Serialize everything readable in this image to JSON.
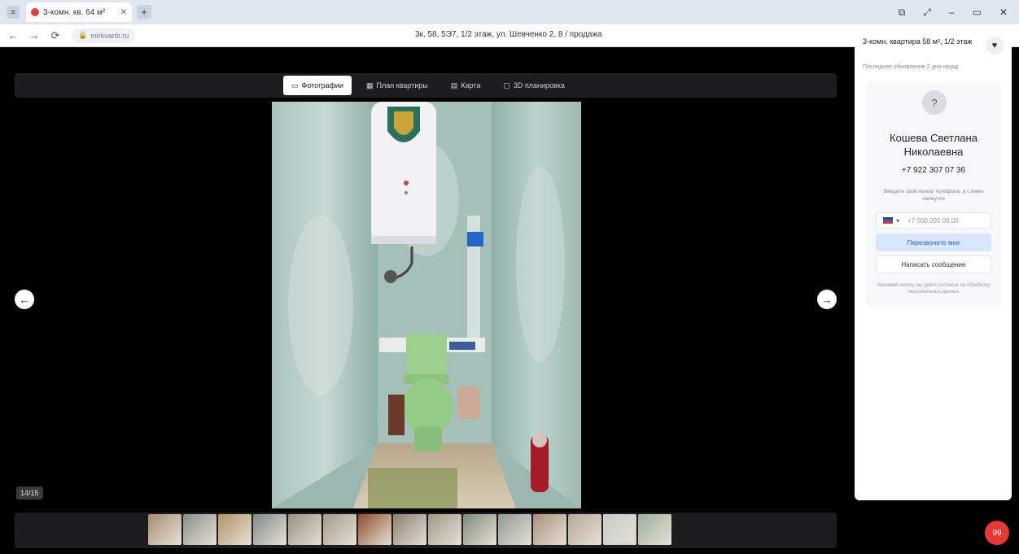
{
  "browser": {
    "tab_title": "3-комн. кв. 64 м²",
    "new_tab": "+",
    "window_controls": [
      "⧉",
      "⤢",
      "–",
      "▭",
      "✕"
    ],
    "site_label": "mirkvartir.ru",
    "url": "3к, 58, 5Э7, 1/2 этаж, ул. Шевченко 2, 8 / продажа",
    "nav": [
      "←",
      "→",
      "⟳",
      "⌂"
    ],
    "right_icons": [
      "☆",
      "⋮",
      "⬚",
      "⤓"
    ]
  },
  "viewer": {
    "close": "✕",
    "tabs": [
      {
        "icon": "▭",
        "label": "Фотографии"
      },
      {
        "icon": "▦",
        "label": "План квартиры"
      },
      {
        "icon": "▤",
        "label": "Карта"
      },
      {
        "icon": "▢",
        "label": "3D планировка"
      }
    ],
    "prev": "←",
    "next": "→",
    "counter": "14/15",
    "thumbnail_colors": [
      "#a58d72",
      "#8a8f86",
      "#b29468",
      "#7f8b86",
      "#9a8f84",
      "#a49a89",
      "#8c4d2b",
      "#8d7e70",
      "#9f9886",
      "#7f8c79",
      "#8f9a94",
      "#a88f7a",
      "#b7a896",
      "#c4cdc4",
      "#9db09a"
    ],
    "active_thumb": 13
  },
  "panel": {
    "heading": "3-комн. квартира 58 м², 1/2 этаж",
    "subheading": "Последнее обновление 2 дня назад",
    "favorite_icon": "♥",
    "avatar_icon": "?",
    "agent_name": "Кошева Светлана Николаевна",
    "phone": "+7 922 307 07 36",
    "note": "Введите свой номер телефона, и с вами свяжутся",
    "phone_placeholder": "+7 000 000 00 00",
    "callback_button": "Перезвоните мне",
    "message_button": "Написать сообщение",
    "legal": "Нажимая кнопку, вы даёте согласие на обработку персональных данных",
    "chat_icon": "99"
  }
}
